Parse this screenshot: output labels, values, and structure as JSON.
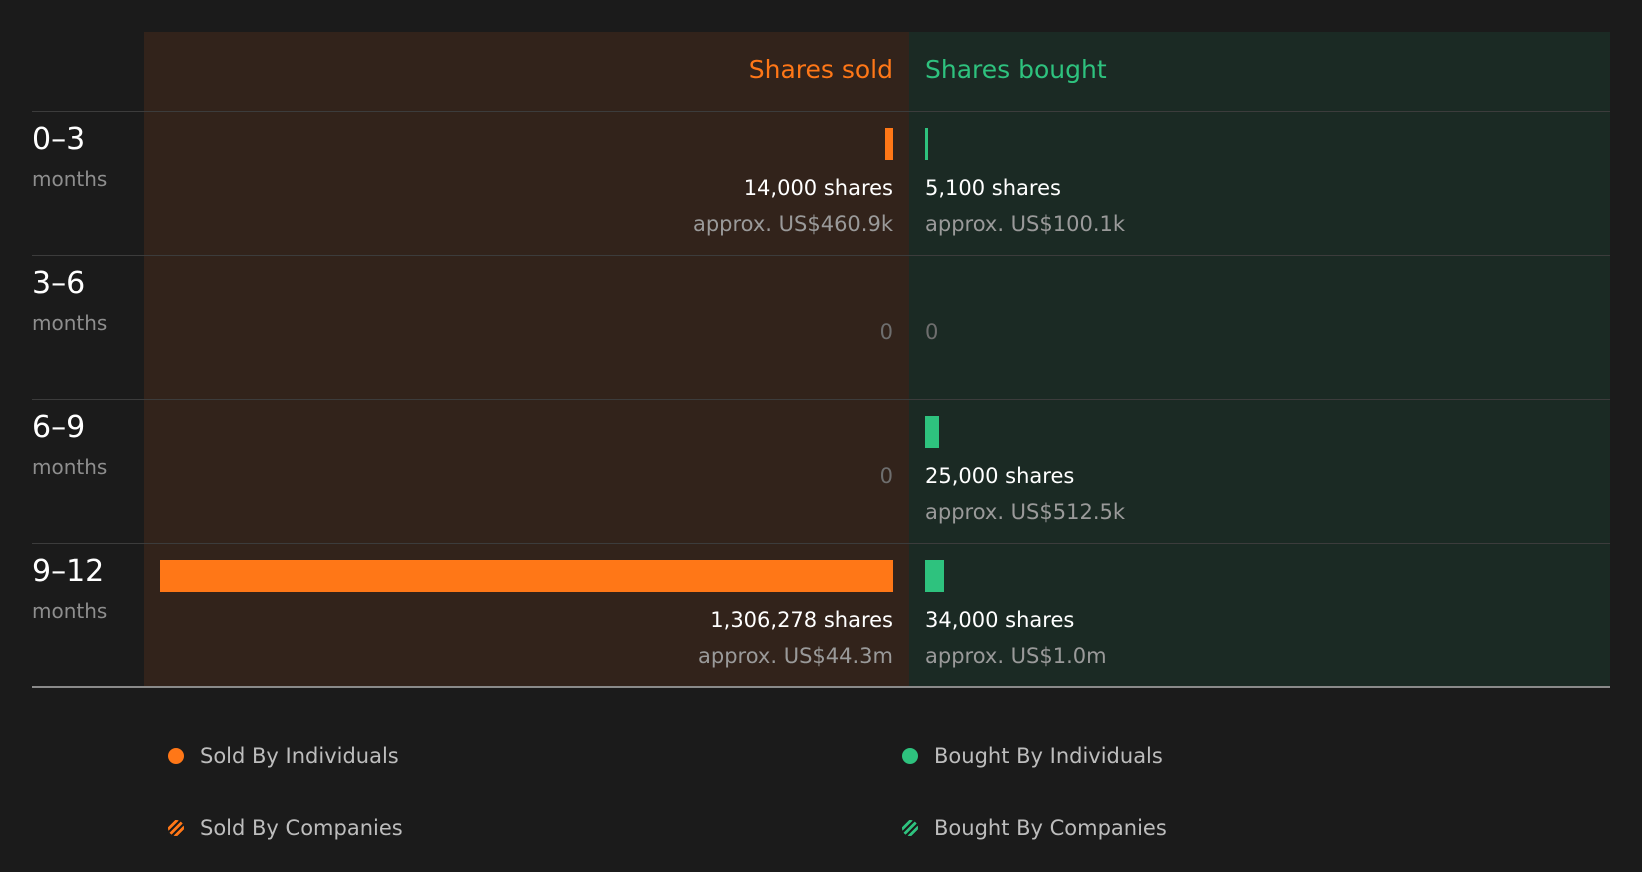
{
  "colors": {
    "sold": "#ff7717",
    "bought": "#2ec27e",
    "sold_panel": "#32231b",
    "bought_panel": "#1b2a24",
    "background": "#1b1b1b"
  },
  "headers": {
    "sold": "Shares sold",
    "bought": "Shares bought"
  },
  "chart_data": {
    "type": "bar",
    "categories": [
      "0–3 months",
      "3–6 months",
      "6–9 months",
      "9–12 months"
    ],
    "series": [
      {
        "name": "Shares sold",
        "values": [
          14000,
          0,
          0,
          1306278
        ]
      },
      {
        "name": "Shares bought",
        "values": [
          5100,
          0,
          25000,
          34000
        ]
      }
    ]
  },
  "periods": [
    {
      "range": "0–3",
      "unit": "months",
      "sold": {
        "shares": 14000,
        "shares_label": "14,000 shares",
        "approx_label": "approx. US$460.9k"
      },
      "bought": {
        "shares": 5100,
        "shares_label": "5,100 shares",
        "approx_label": "approx. US$100.1k"
      }
    },
    {
      "range": "3–6",
      "unit": "months",
      "sold": {
        "shares": 0,
        "zero_label": "0"
      },
      "bought": {
        "shares": 0,
        "zero_label": "0"
      }
    },
    {
      "range": "6–9",
      "unit": "months",
      "sold": {
        "shares": 0,
        "zero_label": "0"
      },
      "bought": {
        "shares": 25000,
        "shares_label": "25,000 shares",
        "approx_label": "approx. US$512.5k"
      }
    },
    {
      "range": "9–12",
      "unit": "months",
      "sold": {
        "shares": 1306278,
        "shares_label": "1,306,278 shares",
        "approx_label": "approx. US$44.3m"
      },
      "bought": {
        "shares": 34000,
        "shares_label": "34,000 shares",
        "approx_label": "approx. US$1.0m"
      }
    }
  ],
  "legend": {
    "sold_individuals": "Sold By Individuals",
    "bought_individuals": "Bought By Individuals",
    "sold_companies": "Sold By Companies",
    "bought_companies": "Bought By Companies"
  }
}
